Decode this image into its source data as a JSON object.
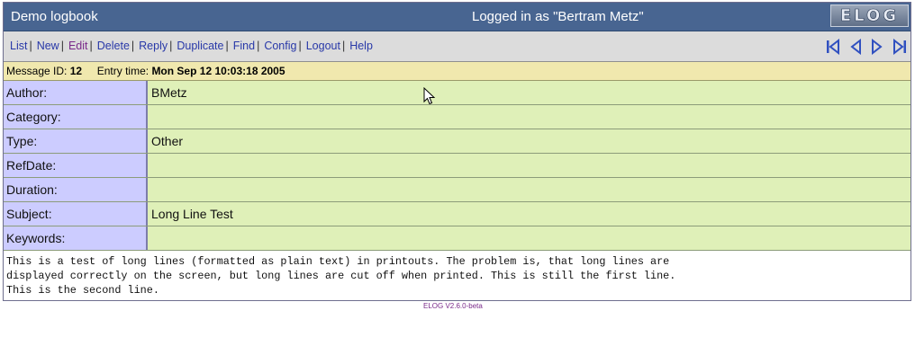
{
  "header": {
    "logbook_name": "Demo logbook",
    "login_status": "Logged in as \"Bertram Metz\"",
    "logo_text": "ELOG"
  },
  "menu": {
    "items": [
      "List",
      "New",
      "Edit",
      "Delete",
      "Reply",
      "Duplicate",
      "Find",
      "Config",
      "Logout",
      "Help"
    ]
  },
  "nav_icons": [
    "first-icon",
    "previous-icon",
    "next-icon",
    "last-icon"
  ],
  "message": {
    "id_label": "Message ID:",
    "id_value": "12",
    "entry_label": "Entry time:",
    "entry_value": "Mon Sep 12 10:03:18 2005"
  },
  "attributes": [
    {
      "label": "Author:",
      "value": "BMetz"
    },
    {
      "label": "Category:",
      "value": ""
    },
    {
      "label": "Type:",
      "value": "Other"
    },
    {
      "label": "RefDate:",
      "value": ""
    },
    {
      "label": "Duration:",
      "value": ""
    },
    {
      "label": "Subject:",
      "value": "Long Line Test"
    },
    {
      "label": "Keywords:",
      "value": ""
    }
  ],
  "body": "This is a test of long lines (formatted as plain text) in printouts. The problem is, that long lines are\ndisplayed correctly on the screen, but long lines are cut off when printed. This is still the first line.\nThis is the second line.",
  "footer": {
    "version": "ELOG V2.6.0-beta"
  },
  "colors": {
    "titlebar": "#486591",
    "label_bg": "#ccccff",
    "value_bg": "#dff0b8",
    "msgbar_bg": "#f0e8ae"
  }
}
